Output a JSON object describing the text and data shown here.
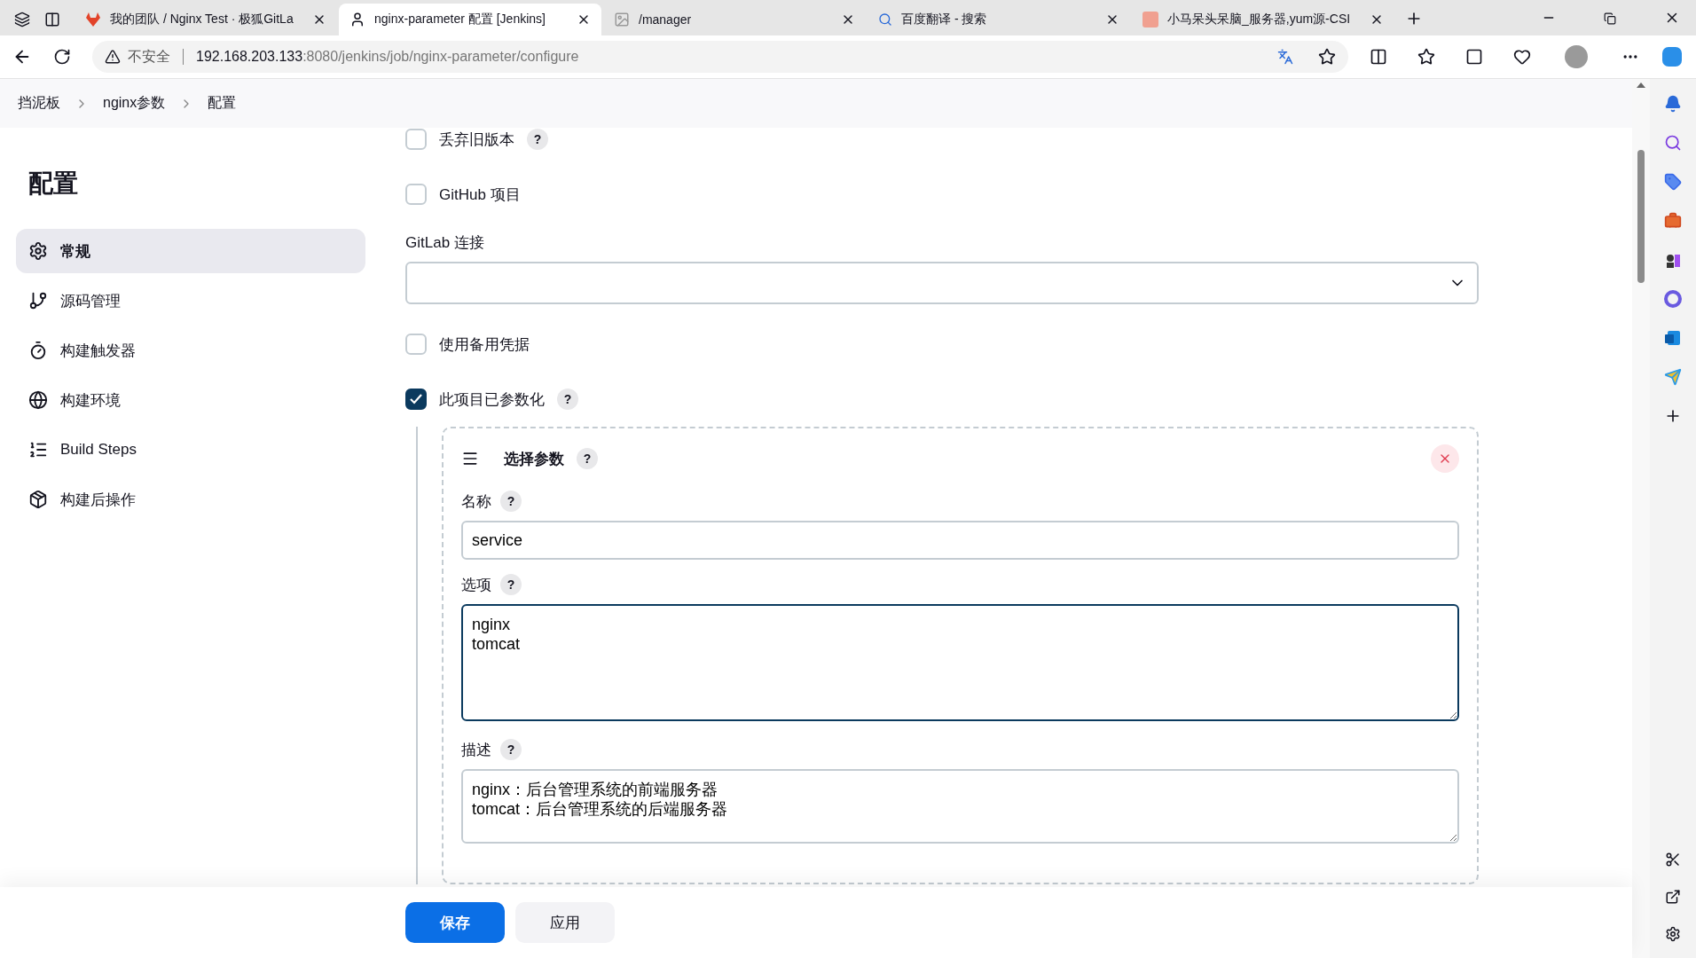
{
  "browser": {
    "tabs": [
      {
        "title": "我的团队 / Nginx Test · 极狐GitLa",
        "selected": false
      },
      {
        "title": "nginx-parameter 配置 [Jenkins]",
        "selected": true
      },
      {
        "title": "/manager",
        "selected": false
      },
      {
        "title": "百度翻译 - 搜索",
        "selected": false
      },
      {
        "title": "小马呆头呆脑_服务器,yum源-CSI",
        "selected": false
      }
    ],
    "address": {
      "warning": "不安全",
      "host": "192.168.203.133",
      "path": ":8080/jenkins/job/nginx-parameter/configure"
    }
  },
  "breadcrumbs": [
    "挡泥板",
    "nginx参数",
    "配置"
  ],
  "sidebar": {
    "title": "配置",
    "items": [
      {
        "label": "常规",
        "selected": true
      },
      {
        "label": "源码管理",
        "selected": false
      },
      {
        "label": "构建触发器",
        "selected": false
      },
      {
        "label": "构建环境",
        "selected": false
      },
      {
        "label": "Build Steps",
        "selected": false
      },
      {
        "label": "构建后操作",
        "selected": false
      }
    ]
  },
  "options": [
    {
      "kind": "checkbox",
      "label": "丢弃旧版本",
      "checked": false,
      "help": "?"
    },
    {
      "kind": "checkbox",
      "label": "GitHub 项目",
      "checked": false
    },
    {
      "kind": "select",
      "label": "GitLab 连接"
    },
    {
      "kind": "checkbox",
      "label": "使用备用凭据",
      "checked": false
    },
    {
      "kind": "checkbox",
      "label": "此项目已参数化",
      "checked": true,
      "help": "?"
    }
  ],
  "parameter": {
    "title": "选择参数",
    "help": "?",
    "fields": [
      {
        "kind": "input",
        "label": "名称",
        "help": "?",
        "value": "service"
      },
      {
        "kind": "textarea",
        "label": "选项",
        "help": "?",
        "value": "nginx\ntomcat",
        "focused": true
      },
      {
        "kind": "textarea",
        "label": "描述",
        "help": "?",
        "value": "nginx：后台管理系统的前端服务器\ntomcat：后台管理系统的后端服务器",
        "focused": false
      }
    ]
  },
  "buttons": [
    {
      "label": "保存",
      "primary": true
    },
    {
      "label": "应用",
      "primary": false
    }
  ]
}
